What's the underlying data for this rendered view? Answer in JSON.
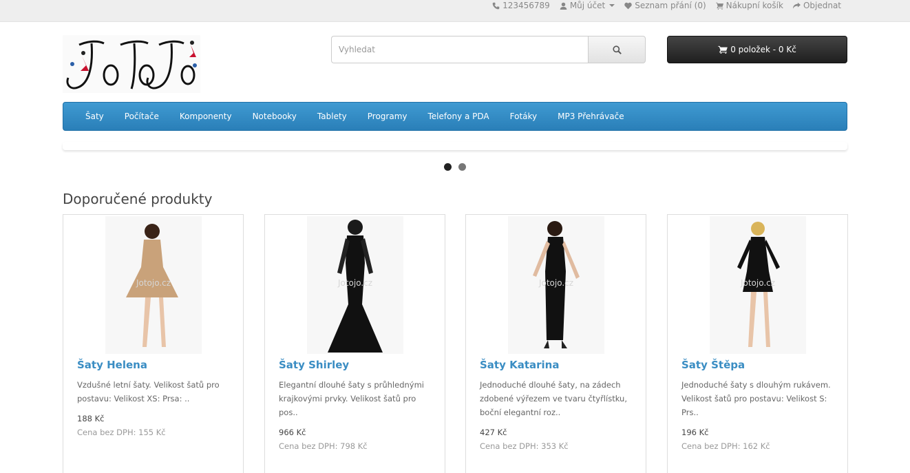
{
  "topbar": {
    "phone": "123456789",
    "account": "Můj účet",
    "wishlist": "Seznam přání (0)",
    "cart": "Nákupní košík",
    "checkout": "Objednat"
  },
  "logo": {
    "text": "JoToJo"
  },
  "search": {
    "placeholder": "Vyhledat"
  },
  "cart_button": {
    "label": "0 položek - 0 Kč"
  },
  "nav": {
    "items": [
      "Šaty",
      "Počítače",
      "Komponenty",
      "Notebooky",
      "Tablety",
      "Programy",
      "Telefony a PDA",
      "Fotáky",
      "MP3 Přehrávače"
    ]
  },
  "slider": {
    "active_index": 0,
    "count": 2
  },
  "featured": {
    "title": "Doporučené produkty",
    "products": [
      {
        "name": "Šaty Helena",
        "desc": "Vzdušné letní šaty.      Velikost šatů pro postavu:   Velikost XS: Prsa: ..",
        "price": "188 Kč",
        "tax": "Cena bez DPH: 155 Kč",
        "watermark": "Jotojo.cz",
        "dress_color": "#c9a27a"
      },
      {
        "name": "Šaty Shirley",
        "desc": "Elegantní dlouhé šaty s průhlednými krajkovými prvky.      Velikost šatů pro pos..",
        "price": "966 Kč",
        "tax": "Cena bez DPH: 798 Kč",
        "watermark": "Jotojo.cz",
        "dress_color": "#111111"
      },
      {
        "name": "Šaty Katarina",
        "desc": "Jednoduché dlouhé šaty, na zádech zdobené výřezem ve tvaru čtyřlístku, boční elegantní roz..",
        "price": "427 Kč",
        "tax": "Cena bez DPH: 353 Kč",
        "watermark": "Jotojo.cz",
        "dress_color": "#111111"
      },
      {
        "name": "Šaty Štěpa",
        "desc": "Jednoduché šaty s dlouhým rukávem.  Velikost šatů pro postavu: Velikost S: Prs..",
        "price": "196 Kč",
        "tax": "Cena bez DPH: 162 Kč",
        "watermark": "Jotojo.cz",
        "dress_color": "#111111"
      }
    ]
  }
}
